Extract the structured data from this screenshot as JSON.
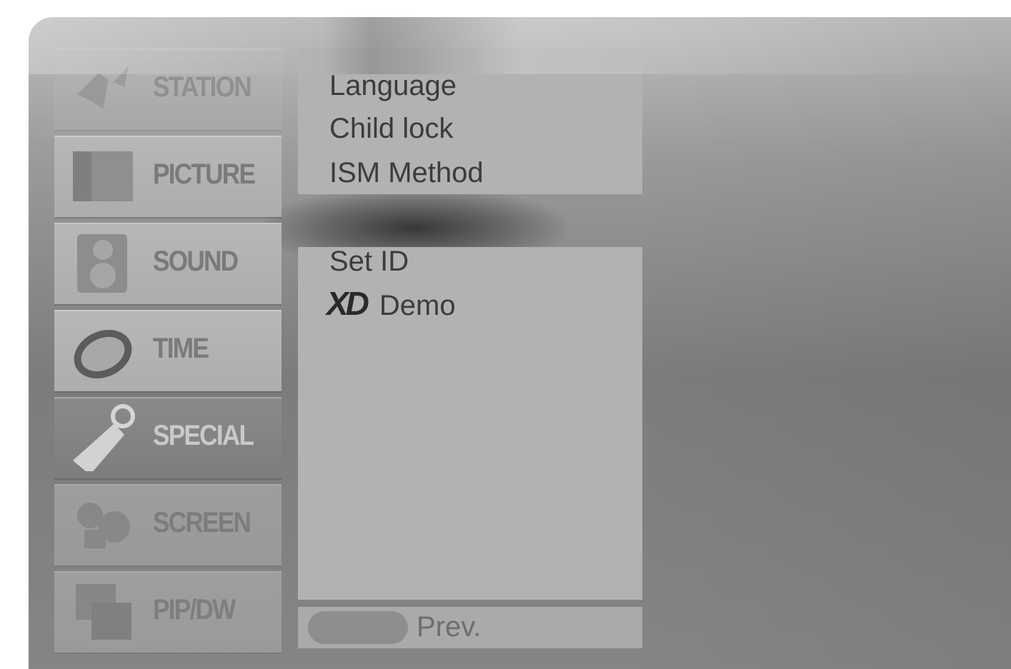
{
  "categories": [
    {
      "label": "STATION",
      "icon": "antenna-icon",
      "state": "dim"
    },
    {
      "label": "PICTURE",
      "icon": "picture-icon",
      "state": "normal"
    },
    {
      "label": "SOUND",
      "icon": "speaker-icon",
      "state": "normal"
    },
    {
      "label": "TIME",
      "icon": "clock-icon",
      "state": "normal"
    },
    {
      "label": "SPECIAL",
      "icon": "tag-icon",
      "state": "active"
    },
    {
      "label": "SCREEN",
      "icon": "screen-icon",
      "state": "dim"
    },
    {
      "label": "PIP/DW",
      "icon": "pip-icon",
      "state": "dim"
    }
  ],
  "options_top": [
    "Language",
    "Child lock",
    "ISM Method"
  ],
  "options_bottom": {
    "set_id": "Set ID",
    "xd_logo": "XD",
    "xd_demo": "Demo"
  },
  "footer": {
    "prev_label": "Prev.",
    "prev_button_icon": "menu-button-icon"
  },
  "colors": {
    "panel": "#b2b2b2",
    "active_category": "#808080",
    "text": "#3c3c3c"
  }
}
